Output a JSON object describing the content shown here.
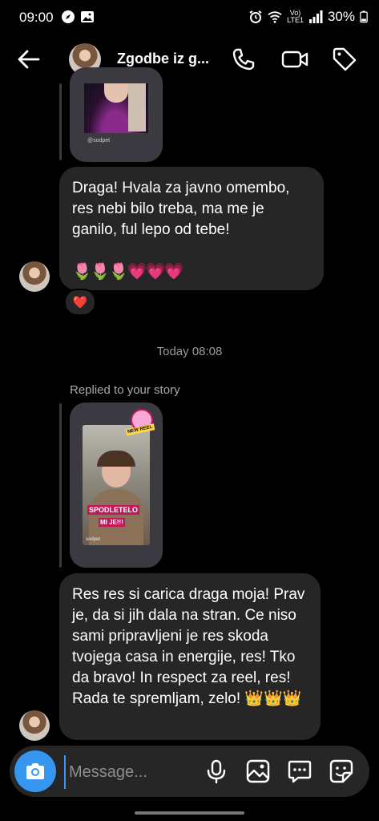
{
  "status": {
    "time": "09:00",
    "network": "Vo)\nLTE1",
    "battery": "30%"
  },
  "header": {
    "title": "Zgodbe iz g..."
  },
  "messages": {
    "story_caption": "@sodpet",
    "msg1": "Draga! Hvala za javno omembo, res nebi bilo treba, ma me je ganilo, ful lepo od tebe!",
    "msg1_emoji": "🌷🌷🌷💗💗💗",
    "reaction": "❤️",
    "timestamp": "Today 08:08",
    "replied_label": "Replied to your story",
    "story2_sticker": "NEW REEL",
    "story2_text1": "SPODLETELO",
    "story2_text2": "MI JE!!!",
    "story2_caption": "sodpet",
    "msg2": "Res res si carica draga moja! Prav je, da si jih dala na stran. Ce niso sami pripravljeni je res skoda tvojega casa in energije, res! Tko da bravo! In respect za reel, res! Rada te spremljam, zelo! 👑👑👑"
  },
  "composer": {
    "placeholder": "Message..."
  },
  "colors": {
    "background": "#000000",
    "bubble": "#262626",
    "accent": "#3797f0"
  },
  "icons": [
    "back-arrow-icon",
    "phone-icon",
    "video-icon",
    "tag-icon",
    "camera-icon",
    "microphone-icon",
    "gallery-icon",
    "chat-bubble-icon",
    "sticker-icon"
  ]
}
